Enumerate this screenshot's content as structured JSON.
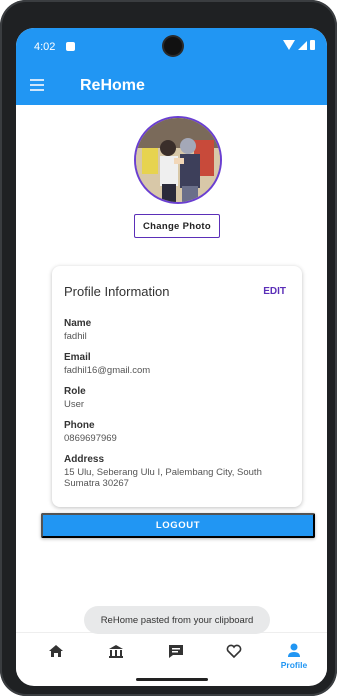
{
  "status_bar": {
    "time": "4:02"
  },
  "app": {
    "title": "ReHome"
  },
  "profile": {
    "change_photo_label": "Change Photo"
  },
  "card": {
    "title": "Profile Information",
    "edit_label": "EDIT",
    "fields": [
      {
        "label": "Name",
        "value": "fadhil"
      },
      {
        "label": "Email",
        "value": "fadhil16@gmail.com"
      },
      {
        "label": "Role",
        "value": "User"
      },
      {
        "label": "Phone",
        "value": "0869697969"
      },
      {
        "label": "Address",
        "value": "15 Ulu, Seberang Ulu I, Palembang City, South Sumatra 30267"
      }
    ]
  },
  "logout_label": "LOGOUT",
  "toast": "ReHome pasted from your clipboard",
  "nav": {
    "items": [
      {
        "icon": "home-icon"
      },
      {
        "icon": "institution-icon"
      },
      {
        "icon": "chat-icon"
      },
      {
        "icon": "heart-icon"
      },
      {
        "icon": "person-icon",
        "label": "Profile"
      }
    ],
    "active_color": "#2196f3",
    "inactive_color": "#333333"
  },
  "colors": {
    "primary": "#2196f3",
    "accent": "#5b2fb8"
  }
}
